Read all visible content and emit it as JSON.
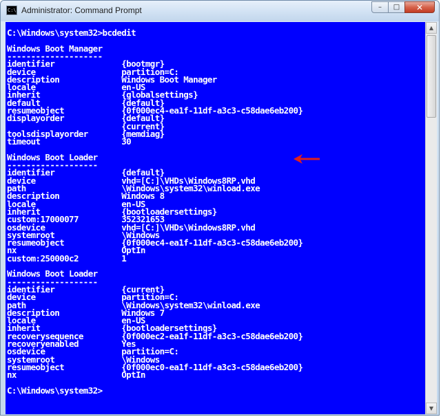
{
  "window": {
    "title": "Administrator: Command Prompt",
    "app_icon_text": "C:\\",
    "controls": {
      "minimize": "–",
      "maximize": "□",
      "close": "✕"
    }
  },
  "console": {
    "lines": [
      "C:\\Windows\\system32>bcdedit",
      "",
      "Windows Boot Manager",
      "--------------------",
      "identifier              {bootmgr}",
      "device                  partition=C:",
      "description             Windows Boot Manager",
      "locale                  en-US",
      "inherit                 {globalsettings}",
      "default                 {default}",
      "resumeobject            {0f000ec4-ea1f-11df-a3c3-c58dae6eb200}",
      "displayorder            {default}",
      "                        {current}",
      "toolsdisplayorder       {memdiag}",
      "timeout                 30",
      "",
      "Windows Boot Loader",
      "-------------------",
      "identifier              {default}",
      "device                  vhd=[C:]\\VHDs\\Windows8RP.vhd",
      "path                    \\Windows\\system32\\winload.exe",
      "description             Windows 8",
      "locale                  en-US",
      "inherit                 {bootloadersettings}",
      "custom:17000077         352321653",
      "osdevice                vhd=[C:]\\VHDs\\Windows8RP.vhd",
      "systemroot              \\Windows",
      "resumeobject            {0f000ec4-ea1f-11df-a3c3-c58dae6eb200}",
      "nx                      OptIn",
      "custom:250000c2         1",
      "",
      "Windows Boot Loader",
      "-------------------",
      "identifier              {current}",
      "device                  partition=C:",
      "path                    \\Windows\\system32\\winload.exe",
      "description             Windows 7",
      "locale                  en-US",
      "inherit                 {bootloadersettings}",
      "recoverysequence        {0f000ec2-ea1f-11df-a3c3-c58dae6eb200}",
      "recoveryenabled         Yes",
      "osdevice                partition=C:",
      "systemroot              \\Windows",
      "resumeobject            {0f000ec0-ea1f-11df-a3c3-c58dae6eb200}",
      "nx                      OptIn",
      "",
      "C:\\Windows\\system32>"
    ]
  },
  "annotation": {
    "icon": "red-arrow-icon",
    "color": "#e0201c"
  },
  "colors": {
    "console_bg": "#0000ff",
    "console_fg": "#ffffff"
  }
}
